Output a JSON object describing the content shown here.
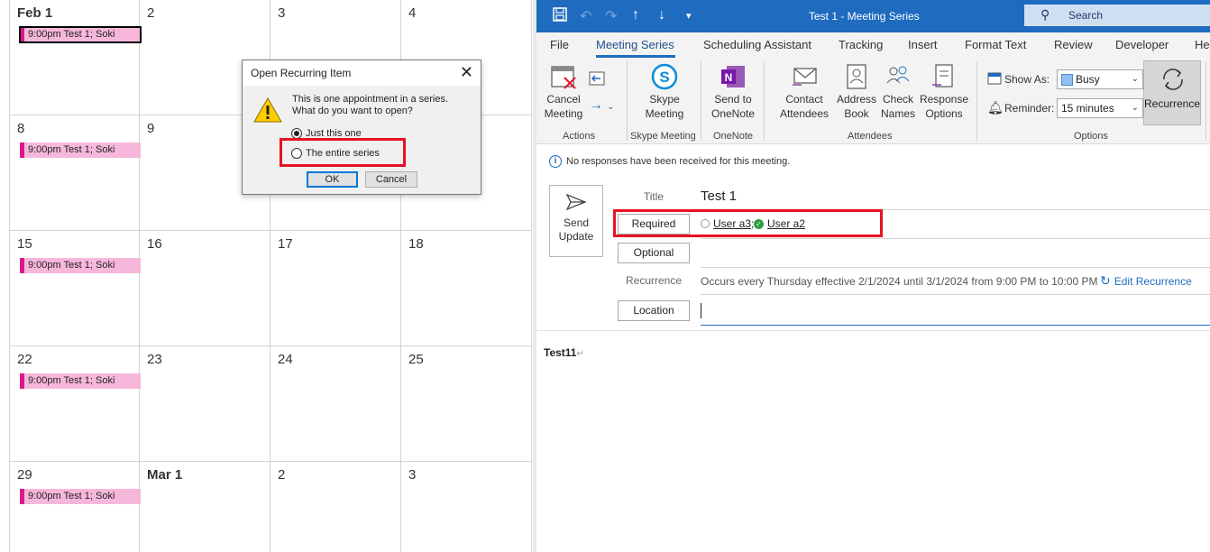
{
  "calendar": {
    "weeks": [
      {
        "days": [
          {
            "label": "Feb 1",
            "bold": true,
            "appt": "9:00pm Test 1; Soki",
            "selected": true
          },
          {
            "label": "2"
          },
          {
            "label": "3"
          },
          {
            "label": "4"
          }
        ]
      },
      {
        "days": [
          {
            "label": "8",
            "appt": "9:00pm Test 1; Soki"
          },
          {
            "label": "9"
          },
          {
            "label": ""
          },
          {
            "label": ""
          }
        ]
      },
      {
        "days": [
          {
            "label": "15",
            "appt": "9:00pm Test 1; Soki"
          },
          {
            "label": "16"
          },
          {
            "label": "17"
          },
          {
            "label": "18"
          }
        ]
      },
      {
        "days": [
          {
            "label": "22",
            "appt": "9:00pm Test 1; Soki"
          },
          {
            "label": "23"
          },
          {
            "label": "24"
          },
          {
            "label": "25"
          }
        ]
      },
      {
        "days": [
          {
            "label": "29",
            "appt": "9:00pm Test 1; Soki"
          },
          {
            "label": "Mar 1",
            "bold": true
          },
          {
            "label": "2"
          },
          {
            "label": "3"
          }
        ]
      }
    ]
  },
  "dialog": {
    "title": "Open Recurring Item",
    "message": "This is one appointment in a series. What do you want to open?",
    "options": [
      "Just this one",
      "The entire series"
    ],
    "selected_option": "Just this one",
    "ok_label": "OK",
    "cancel_label": "Cancel"
  },
  "outlook": {
    "window_title": "Test 1  -  Meeting Series",
    "search_label": "Search",
    "tabs": [
      "File",
      "Meeting Series",
      "Scheduling Assistant",
      "Tracking",
      "Insert",
      "Format Text",
      "Review",
      "Developer",
      "He"
    ],
    "active_tab": "Meeting Series",
    "ribbon": {
      "cancel_meeting": "Cancel\nMeeting",
      "skype_meeting": "Skype\nMeeting",
      "send_to_onenote": "Send to\nOneNote",
      "contact_attendees": "Contact\nAttendees",
      "address_book": "Address\nBook",
      "check_names": "Check\nNames",
      "response_options": "Response\nOptions",
      "show_as_label": "Show As:",
      "show_as_value": "Busy",
      "reminder_label": "Reminder:",
      "reminder_value": "15 minutes",
      "recurrence_label": "Recurrence",
      "groups": [
        "Actions",
        "Skype Meeting",
        "OneNote",
        "Attendees",
        "Options"
      ]
    },
    "info_message": "No responses have been received for this meeting.",
    "send_update": "Send\nUpdate",
    "fields": {
      "title_label": "Title",
      "title_value": "Test 1",
      "required_label": "Required",
      "optional_label": "Optional",
      "recurrence_label": "Recurrence",
      "recurrence_value": "Occurs every Thursday effective 2/1/2024 until 3/1/2024 from 9:00 PM to 10:00 PM",
      "edit_recurrence": "Edit Recurrence",
      "location_label": "Location"
    },
    "attendees": [
      {
        "name": "User a3",
        "suffix": ";",
        "status": "none"
      },
      {
        "name": "User a2",
        "suffix": "",
        "status": "accepted"
      }
    ],
    "body_text": "Test11",
    "colors": {
      "accent": "#1f6bbf",
      "appointment": "#f7b7db",
      "appointment_bar": "#d81b8a",
      "highlight": "#e81123"
    }
  }
}
